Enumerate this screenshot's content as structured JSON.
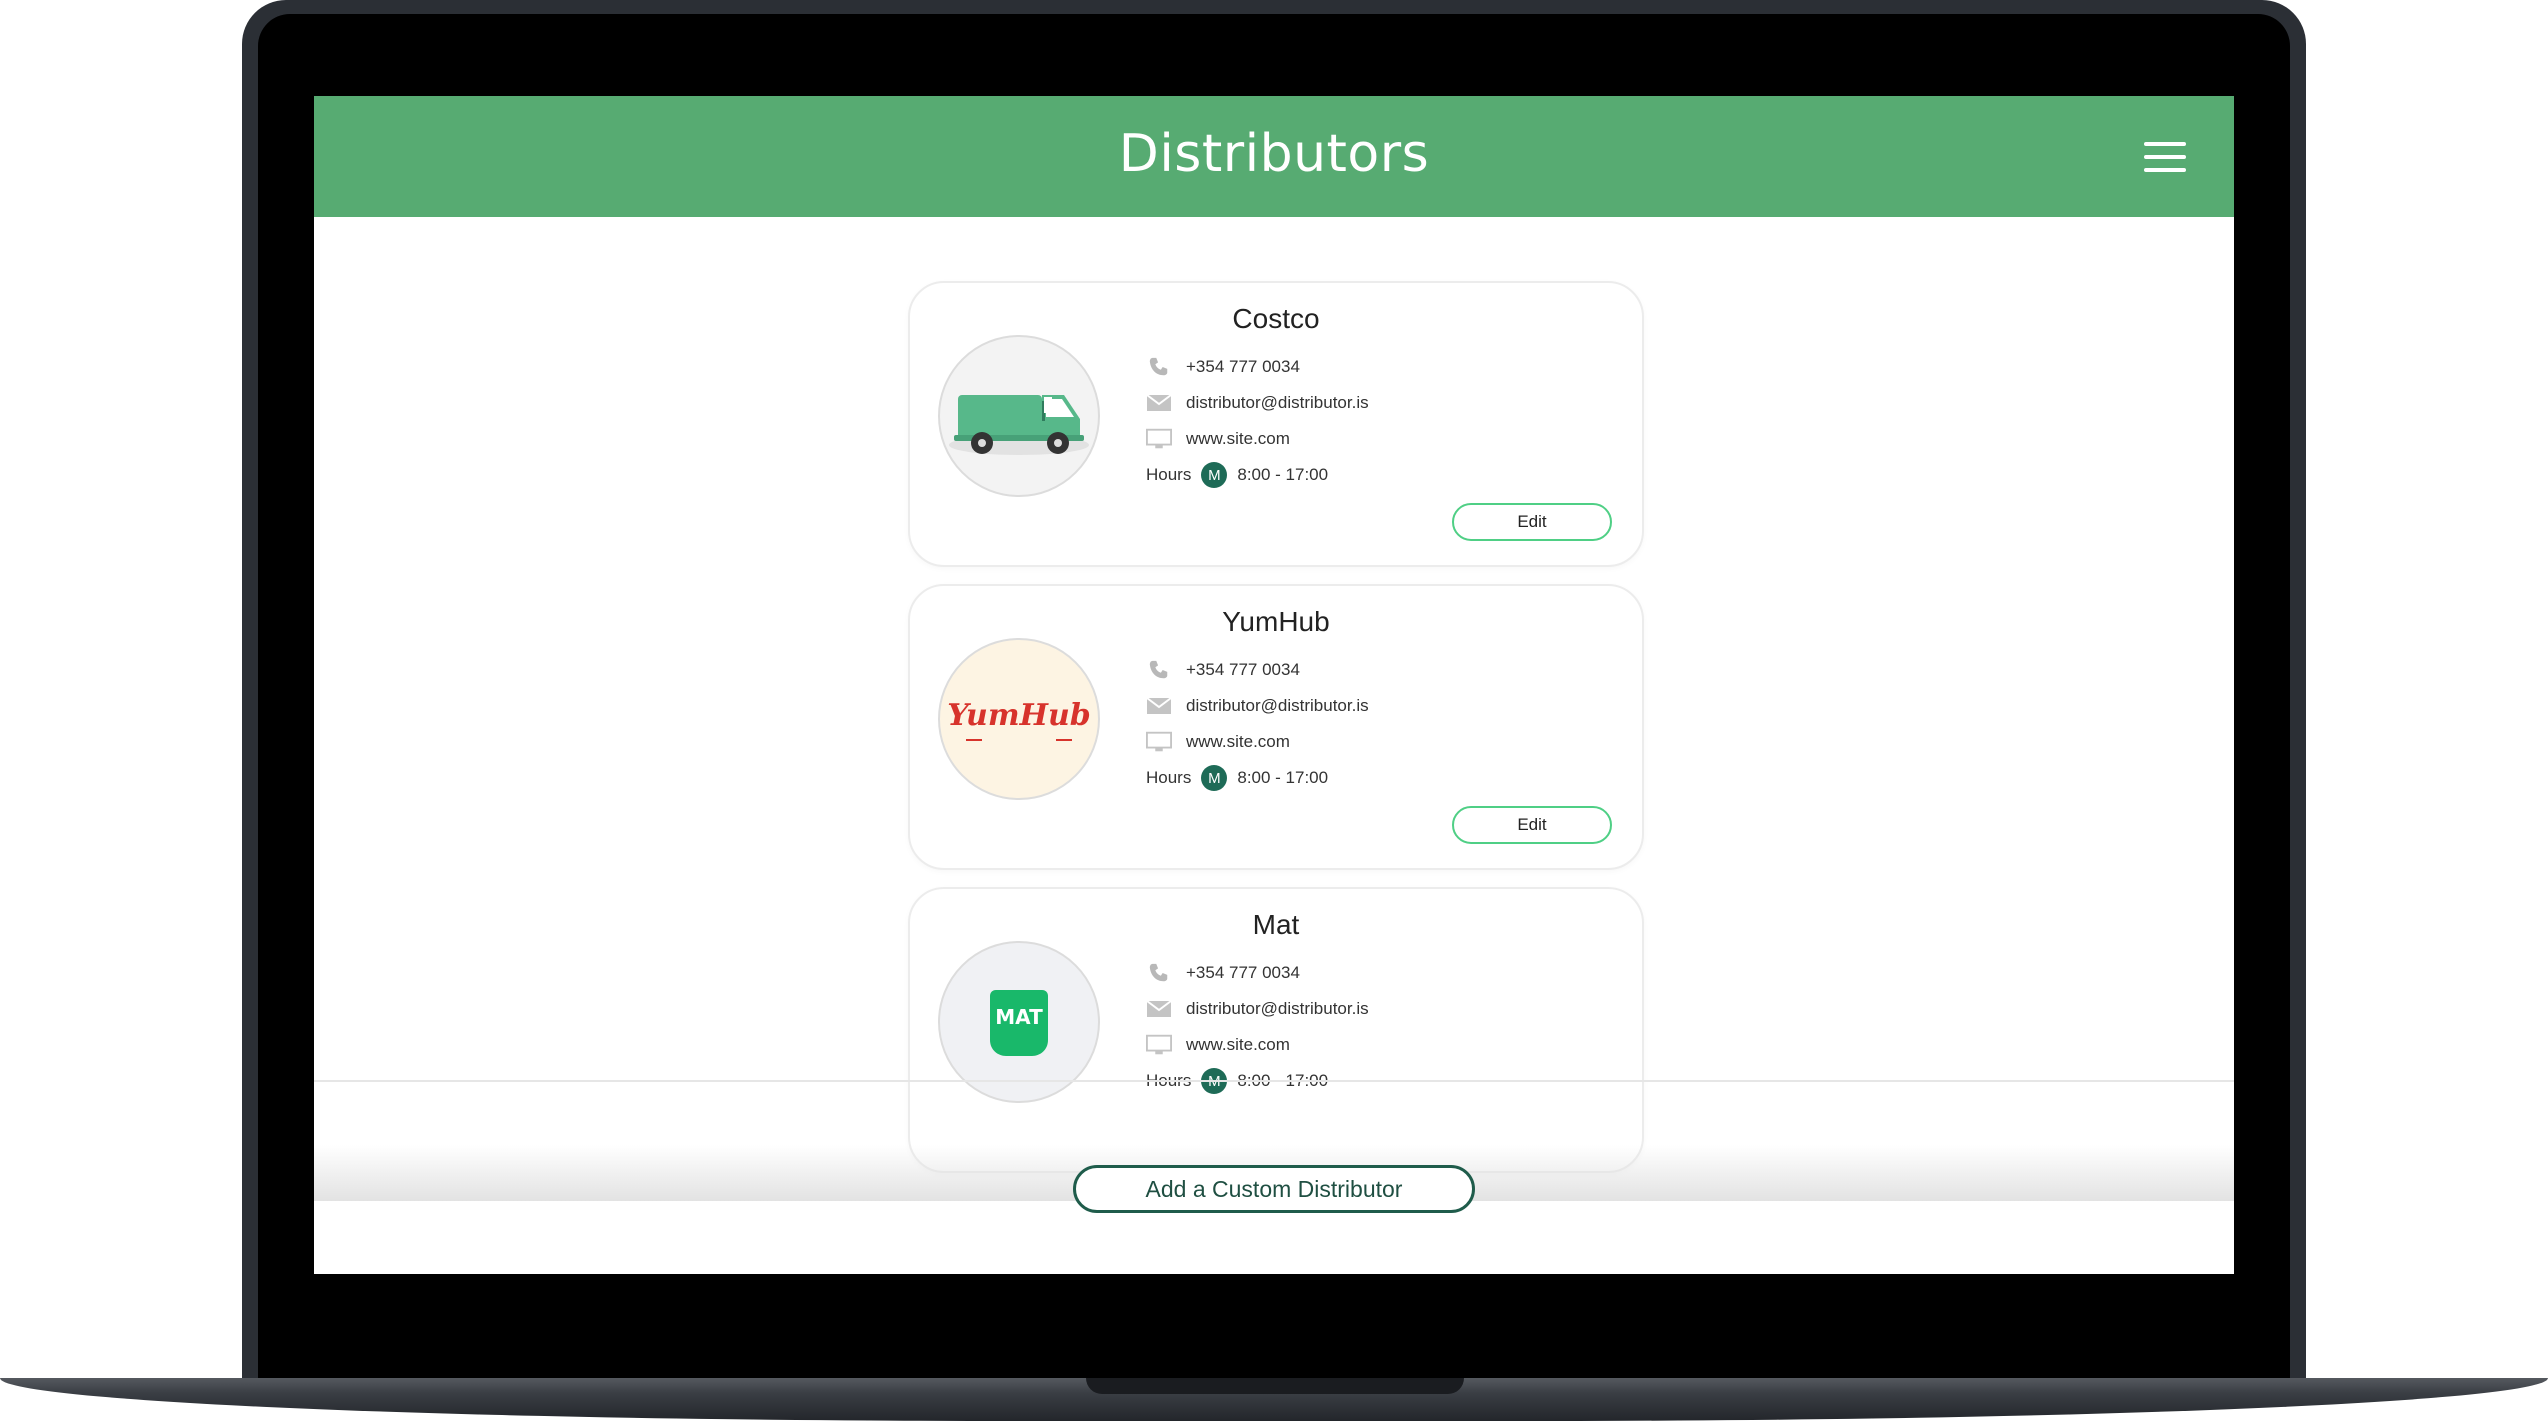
{
  "header": {
    "title": "Distributors"
  },
  "distributors": [
    {
      "name": "Costco",
      "phone": "+354 777 0034",
      "email": "distributor@distributor.is",
      "website": "www.site.com",
      "hours_label": "Hours",
      "day": "M",
      "hours": "8:00  - 17:00",
      "edit_label": "Edit"
    },
    {
      "name": "YumHub",
      "phone": "+354 777 0034",
      "email": "distributor@distributor.is",
      "website": "www.site.com",
      "hours_label": "Hours",
      "day": "M",
      "hours": "8:00  - 17:00",
      "edit_label": "Edit",
      "logo_text": "YumHub"
    },
    {
      "name": "Mat",
      "phone": "+354 777 0034",
      "email": "distributor@distributor.is",
      "website": "www.site.com",
      "hours_label": "Hours",
      "day": "M",
      "hours": "8:00  - 17:00",
      "logo_text": "MAT"
    }
  ],
  "footer": {
    "add_label": "Add a Custom Distributor"
  },
  "colors": {
    "header": "#57ab72",
    "accent": "#4fcf85",
    "dark_green": "#1e6b57"
  }
}
